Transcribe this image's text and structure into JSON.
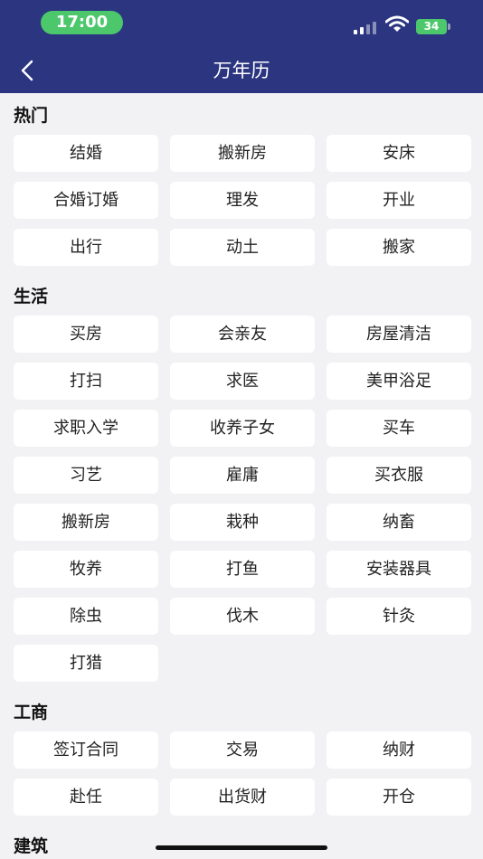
{
  "status_bar": {
    "time": "17:00",
    "battery": "34"
  },
  "header": {
    "title": "万年历"
  },
  "sections": [
    {
      "title": "热门",
      "items": [
        "结婚",
        "搬新房",
        "安床",
        "合婚订婚",
        "理发",
        "开业",
        "出行",
        "动土",
        "搬家"
      ]
    },
    {
      "title": "生活",
      "items": [
        "买房",
        "会亲友",
        "房屋清洁",
        "打扫",
        "求医",
        "美甲浴足",
        "求职入学",
        "收养子女",
        "买车",
        "习艺",
        "雇庸",
        "买衣服",
        "搬新房",
        "栽种",
        "纳畜",
        "牧养",
        "打鱼",
        "安装器具",
        "除虫",
        "伐木",
        "针灸",
        "打猎"
      ]
    },
    {
      "title": "工商",
      "items": [
        "签订合同",
        "交易",
        "纳财",
        "赴任",
        "出货财",
        "开仓"
      ]
    },
    {
      "title": "建筑",
      "items": []
    }
  ]
}
